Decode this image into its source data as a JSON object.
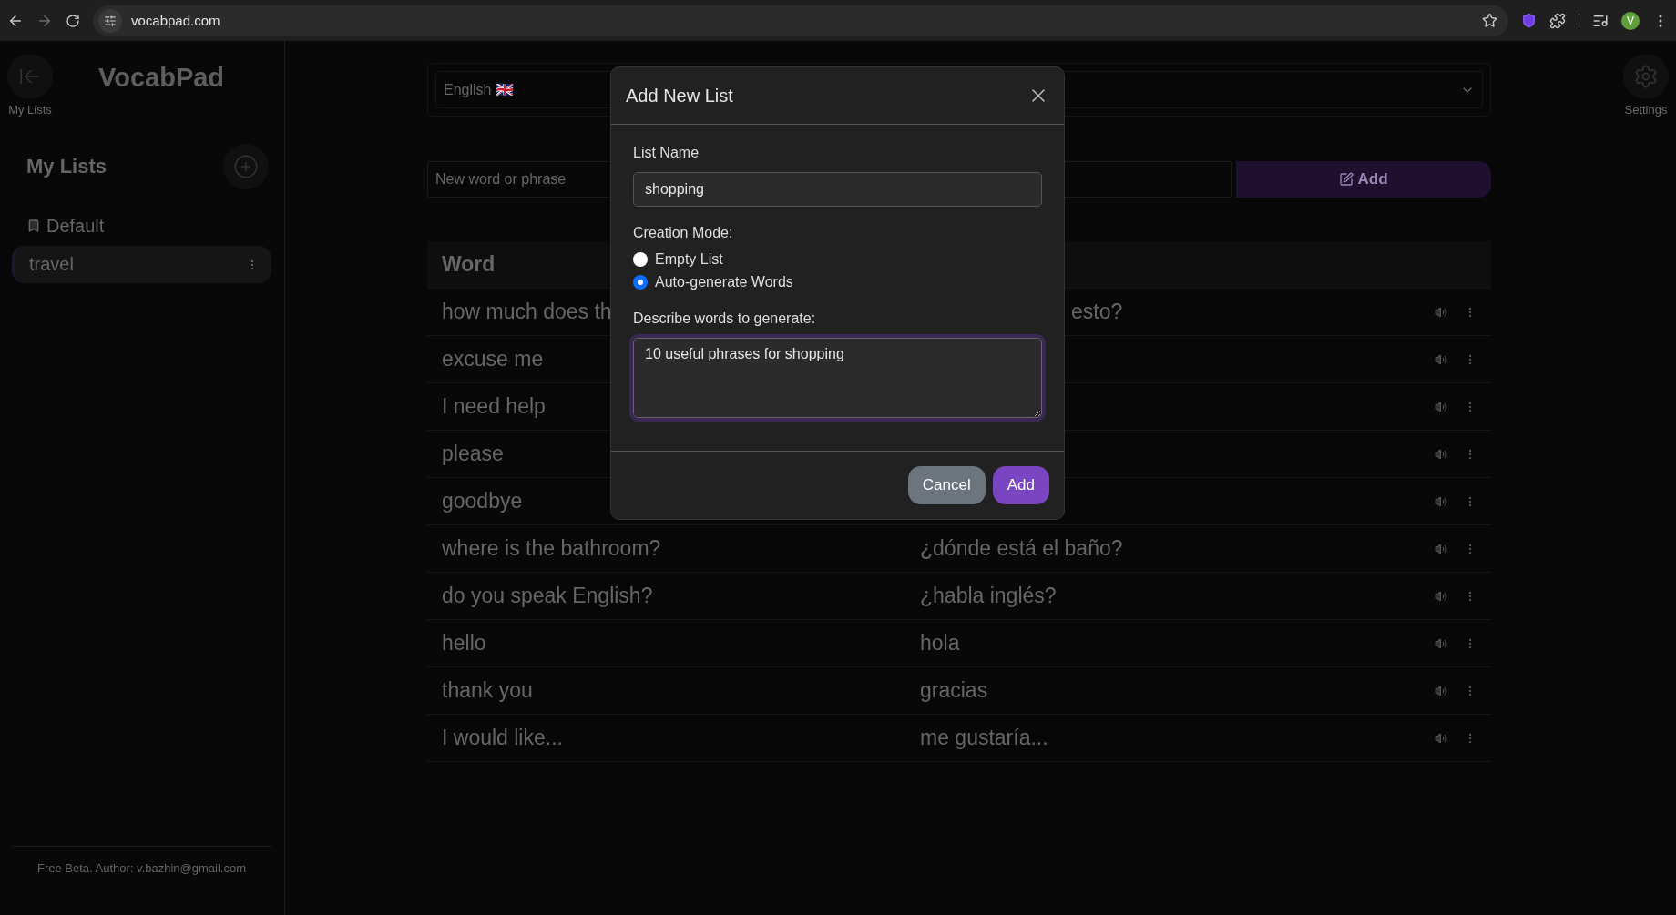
{
  "browser": {
    "url": "vocabpad.com",
    "avatar": "V"
  },
  "sidebar": {
    "back_label": "My Lists",
    "app_title": "VocabPad",
    "heading": "My Lists",
    "lists": [
      {
        "label": "Default",
        "kind": "folder",
        "selected": false
      },
      {
        "label": "travel",
        "kind": "list",
        "selected": true
      }
    ],
    "footer": "Free Beta. Author: v.bazhin@gmail.com"
  },
  "settings_label": "Settings",
  "language": {
    "source": "English 🇬🇧"
  },
  "new_word": {
    "placeholder": "New word or phrase",
    "button": "Add"
  },
  "table": {
    "columns": [
      "Word"
    ],
    "rows": [
      {
        "word": "how much does th",
        "translation": "esto?",
        "cut_left": true
      },
      {
        "word": "excuse me"
      },
      {
        "word": "I need help"
      },
      {
        "word": "please"
      },
      {
        "word": "goodbye"
      },
      {
        "word": "where is the bathroom?",
        "translation": "¿dónde está el baño?"
      },
      {
        "word": "do you speak English?",
        "translation": "¿habla inglés?"
      },
      {
        "word": "hello",
        "translation": "hola"
      },
      {
        "word": "thank you",
        "translation": "gracias"
      },
      {
        "word": "I would like...",
        "translation": "me gustaría..."
      }
    ]
  },
  "dialog": {
    "title": "Add New List",
    "name_label": "List Name",
    "name_value": "shopping",
    "mode_label": "Creation Mode:",
    "modes": [
      {
        "label": "Empty List",
        "selected": false
      },
      {
        "label": "Auto-generate Words",
        "selected": true
      }
    ],
    "describe_label": "Describe words to generate:",
    "describe_value": "10 useful phrases for shopping",
    "cancel": "Cancel",
    "confirm": "Add"
  }
}
